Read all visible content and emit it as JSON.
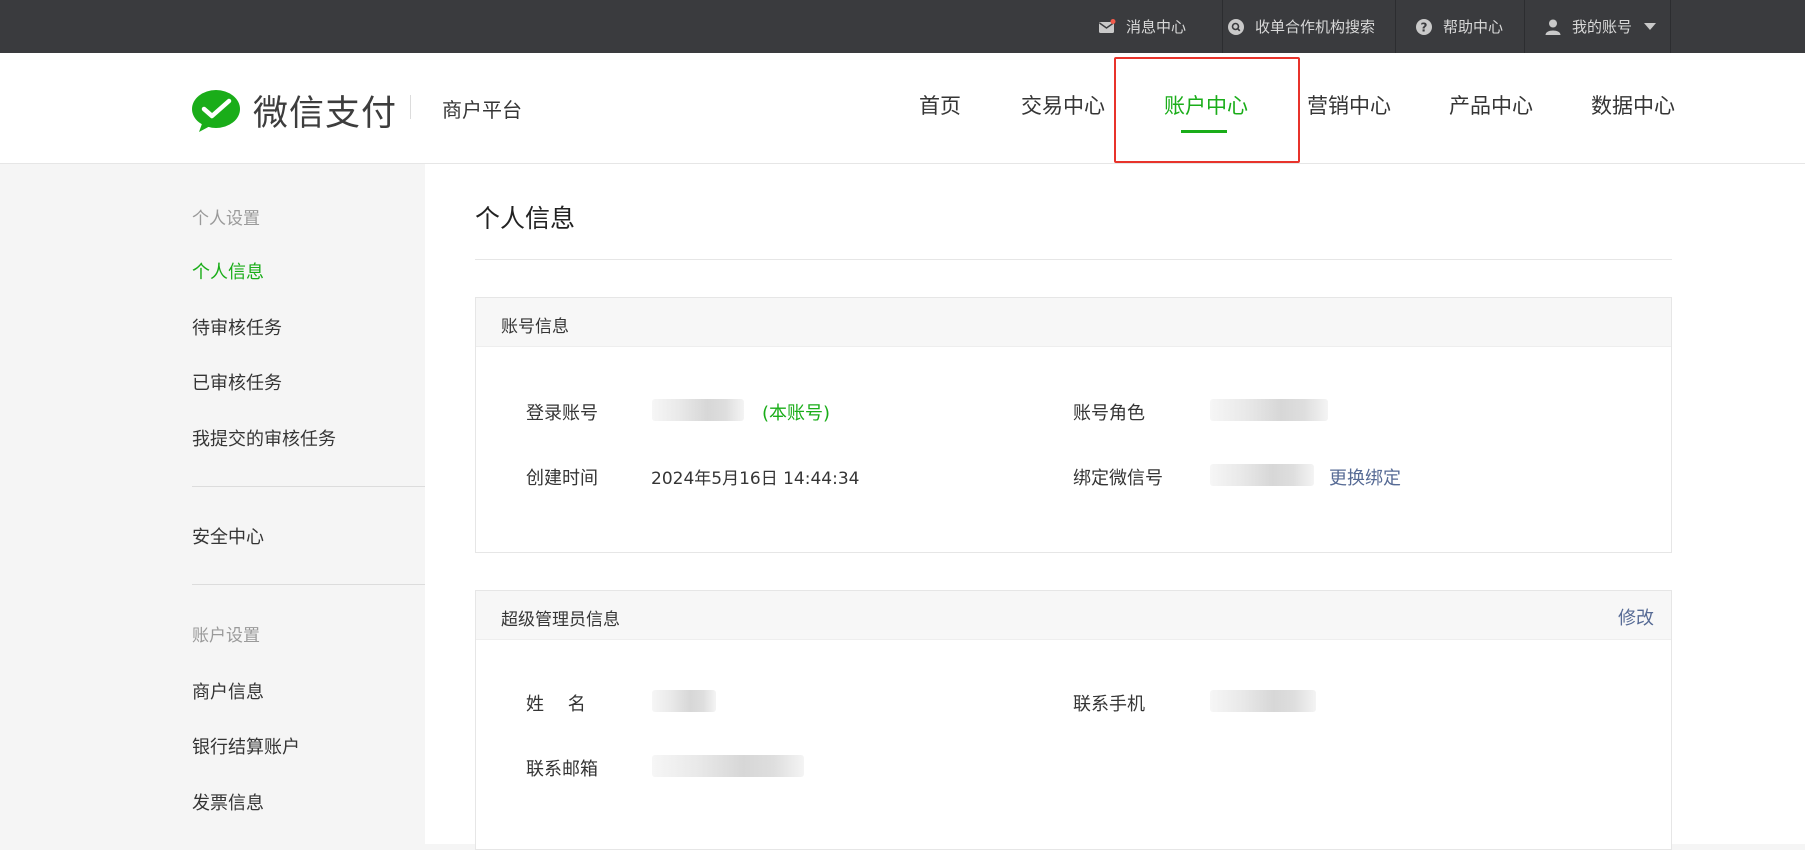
{
  "topbar": {
    "messages": "消息中心",
    "search_agency": "收单合作机构搜索",
    "help": "帮助中心",
    "my_account": "我的账号"
  },
  "header": {
    "logo_text": "微信支付",
    "platform": "商户平台",
    "nav": [
      {
        "label": "首页"
      },
      {
        "label": "交易中心"
      },
      {
        "label": "账户中心",
        "active": true
      },
      {
        "label": "营销中心"
      },
      {
        "label": "产品中心"
      },
      {
        "label": "数据中心"
      }
    ]
  },
  "sidebar": {
    "groups": [
      {
        "title": "个人设置",
        "items": [
          "个人信息",
          "待审核任务",
          "已审核任务",
          "我提交的审核任务"
        ]
      },
      {
        "title": "",
        "items": [
          "安全中心"
        ]
      },
      {
        "title": "账户设置",
        "items": [
          "商户信息",
          "银行结算账户",
          "发票信息"
        ]
      }
    ],
    "active_item": "个人信息"
  },
  "main": {
    "page_title": "个人信息",
    "account_panel": {
      "title": "账号信息",
      "login_label": "登录账号",
      "this_account": "(本账号)",
      "role_label": "账号角色",
      "created_label": "创建时间",
      "created_value": "2024年5月16日 14:44:34",
      "wechat_label": "绑定微信号",
      "rebind_link": "更换绑定"
    },
    "admin_panel": {
      "title": "超级管理员信息",
      "edit_link": "修改",
      "name_label": "姓　 名",
      "phone_label": "联系手机",
      "email_label": "联系邮箱"
    }
  },
  "colors": {
    "accent": "#1aad19",
    "link": "#576b95",
    "topbar_bg": "#3a3b3e",
    "highlight_box": "#e8332b"
  }
}
